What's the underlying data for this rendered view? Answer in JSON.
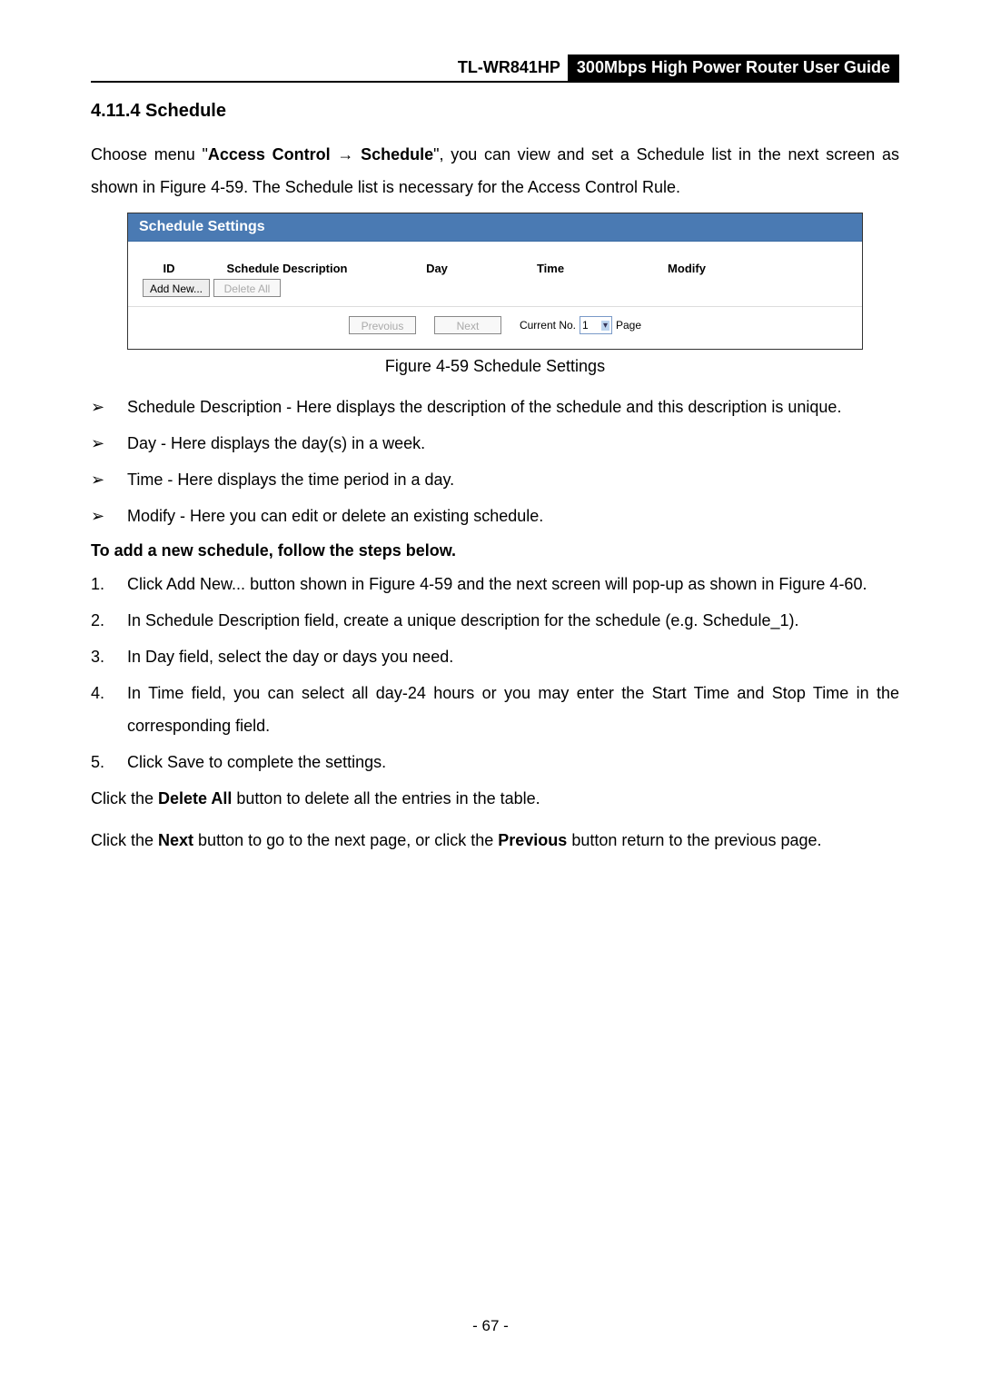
{
  "header": {
    "model": "TL-WR841HP",
    "guide": "300Mbps High Power Router User Guide"
  },
  "section": {
    "title": "4.11.4 Schedule"
  },
  "intro": {
    "pre": "Choose menu \"",
    "b1": "Access Control",
    "arrow": "→",
    "b2": "Schedule",
    "post": "\", you can view and set a Schedule list in the next screen as shown in Figure 4-59. The Schedule list is necessary for the Access Control Rule."
  },
  "screenshot": {
    "panel_title": "Schedule Settings",
    "cols": {
      "id": "ID",
      "desc": "Schedule Description",
      "day": "Day",
      "time": "Time",
      "modify": "Modify"
    },
    "buttons": {
      "add_new": "Add New...",
      "delete_all": "Delete All",
      "previous": "Prevoius",
      "next": "Next"
    },
    "pager": {
      "current_no": "Current No.",
      "value": "1",
      "page": "Page"
    }
  },
  "figure_caption": "Figure 4-59   Schedule Settings",
  "bullets": {
    "mk": "➢",
    "items": [
      {
        "b": "Schedule Description - ",
        "t": "Here displays the description of the schedule and this description is unique."
      },
      {
        "b": "Day - ",
        "t": "Here displays the day(s) in a week."
      },
      {
        "b": "Time - ",
        "t": "Here displays the time period in a day."
      },
      {
        "b": "Modify - ",
        "t": "Here you can edit or delete an existing schedule."
      }
    ]
  },
  "subhead": "To add a new schedule, follow the steps below.",
  "steps": [
    {
      "n": "1.",
      "pre": "Click ",
      "b": "Add New...",
      "post": " button shown in Figure 4-59 and the next screen will pop-up as shown in Figure 4-60."
    },
    {
      "n": "2.",
      "pre": "In ",
      "b": "Schedule Description",
      "post": " field, create a unique description for the schedule (e.g. Schedule_1)."
    },
    {
      "n": "3.",
      "pre": "In ",
      "b": "Day",
      "post": " field, select the day or days you need."
    },
    {
      "n": "4.",
      "pre": "In ",
      "b": "Time",
      "post": " field, you can select all day-24 hours or you may enter the Start Time and Stop Time in the corresponding field."
    },
    {
      "n": "5.",
      "pre": "Click ",
      "b": "Save",
      "post": " to complete the settings."
    }
  ],
  "tail": {
    "p1_pre": "Click the ",
    "p1_b": "Delete All",
    "p1_post": " button to delete all the entries in the table.",
    "p2_pre": "Click the ",
    "p2_b1": "Next",
    "p2_mid": " button to go to the next page, or click the ",
    "p2_b2": "Previous",
    "p2_post": " button return to the previous page."
  },
  "pagenum": "- 67 -"
}
